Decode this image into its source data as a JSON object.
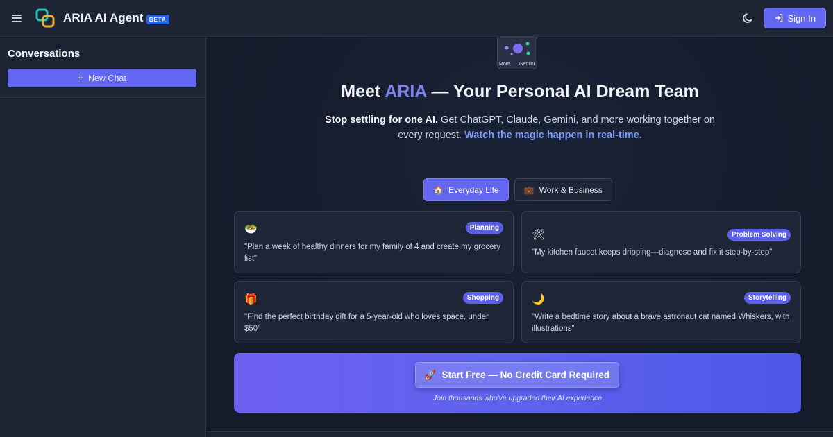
{
  "header": {
    "app_title": "ARIA AI Agent",
    "beta_badge": "BETA",
    "signin_label": "Sign In"
  },
  "sidebar": {
    "title": "Conversations",
    "new_chat_label": "New Chat"
  },
  "hero": {
    "card_labels": [
      "More",
      "Gemini"
    ],
    "title_prefix": "Meet ",
    "title_accent": "ARIA",
    "title_suffix": " — Your Personal AI Dream Team",
    "subtitle_bold": "Stop settling for one AI.",
    "subtitle_text": " Get ChatGPT, Claude, Gemini, and more working together on every request. ",
    "subtitle_link": "Watch the magic happen in real-time."
  },
  "tabs": [
    {
      "icon": "🏠",
      "label": "Everyday Life",
      "active": true
    },
    {
      "icon": "💼",
      "label": "Work & Business",
      "active": false
    }
  ],
  "cards": [
    {
      "icon": "🥗",
      "tag": "Planning",
      "text": "\"Plan a week of healthy dinners for my family of 4 and create my grocery list\""
    },
    {
      "icon": "🛠",
      "tag": "Problem Solving",
      "text": "\"My kitchen faucet keeps dripping—diagnose and fix it step-by-step\""
    },
    {
      "icon": "🎁",
      "tag": "Shopping",
      "text": "\"Find the perfect birthday gift for a 5-year-old who loves space, under $50\""
    },
    {
      "icon": "🌙",
      "tag": "Storytelling",
      "text": "\"Write a bedtime story about a brave astronaut cat named Whiskers, with illustrations\""
    }
  ],
  "cta": {
    "icon": "🚀",
    "button_label": "Start Free — No Credit Card Required",
    "note": "Join thousands who've upgraded their AI experience"
  },
  "colors": {
    "accent": "#6366f1",
    "background": "#141b2b",
    "panel": "#1d2434"
  }
}
